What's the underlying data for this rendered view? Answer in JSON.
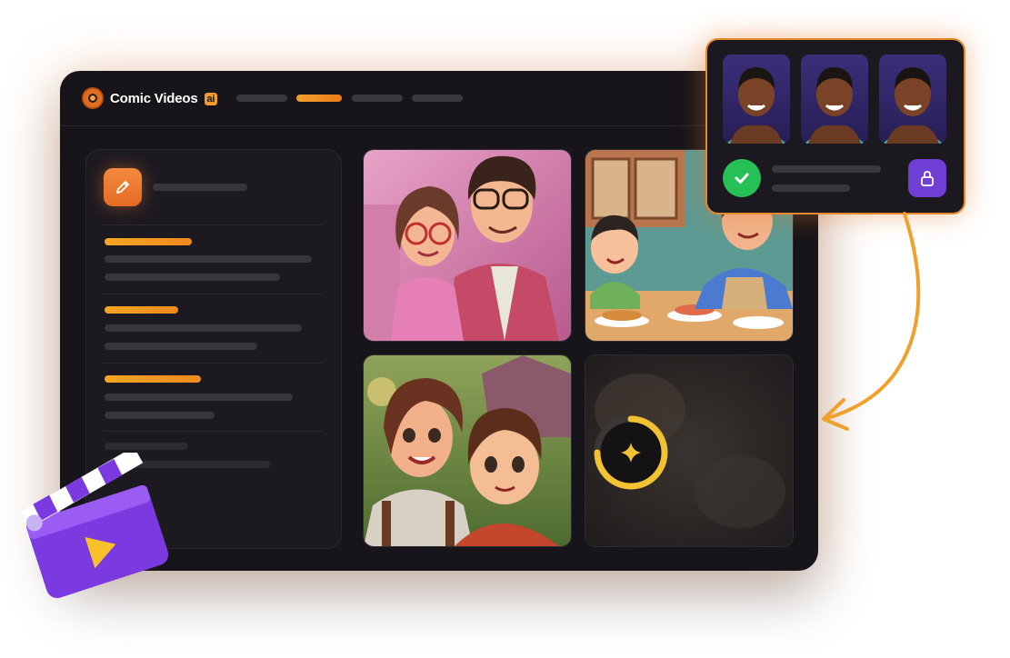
{
  "app": {
    "brand_name": "Comic Videos",
    "brand_badge": "ai",
    "nav_active_index": 1
  },
  "icons": {
    "logo": "film-reel-icon",
    "edit": "pencil-icon",
    "generate": "sparkle-icon",
    "confirm": "checkmark-icon",
    "lock": "lock-icon",
    "clapper": "clapperboard-play-icon"
  },
  "colors": {
    "accent": "#f0a02c",
    "window_bg": "#17151a",
    "panel_bg": "#1c1a20",
    "confirm": "#27c056",
    "lock": "#6f3fd6",
    "loader": "#f1c232"
  },
  "gallery": {
    "tiles": [
      {
        "name": "couple-with-glasses-image"
      },
      {
        "name": "kitchen-cooking-image"
      },
      {
        "name": "mother-and-son-image"
      },
      {
        "name": "generating-placeholder"
      }
    ],
    "loader_progress": 0.75
  },
  "characters": {
    "count": 3,
    "selected": true
  }
}
